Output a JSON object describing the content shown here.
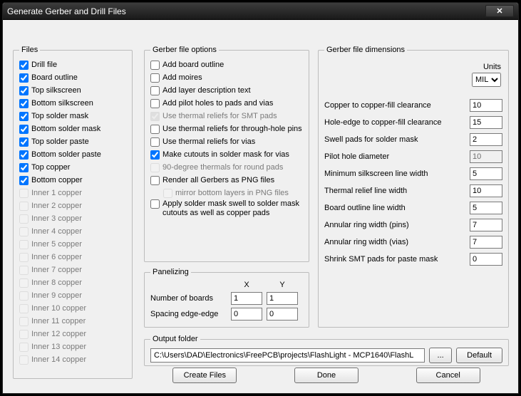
{
  "title": "Generate Gerber and Drill Files",
  "files": {
    "legend": "Files",
    "items": [
      {
        "label": "Drill file",
        "checked": true,
        "enabled": true
      },
      {
        "label": "Board outline",
        "checked": true,
        "enabled": true
      },
      {
        "label": "Top silkscreen",
        "checked": true,
        "enabled": true
      },
      {
        "label": "Bottom silkscreen",
        "checked": true,
        "enabled": true
      },
      {
        "label": "Top solder mask",
        "checked": true,
        "enabled": true
      },
      {
        "label": "Bottom solder mask",
        "checked": true,
        "enabled": true
      },
      {
        "label": "Top solder paste",
        "checked": true,
        "enabled": true
      },
      {
        "label": "Bottom solder paste",
        "checked": true,
        "enabled": true
      },
      {
        "label": "Top copper",
        "checked": true,
        "enabled": true
      },
      {
        "label": "Bottom copper",
        "checked": true,
        "enabled": true
      },
      {
        "label": "Inner 1 copper",
        "checked": false,
        "enabled": false
      },
      {
        "label": "Inner 2 copper",
        "checked": false,
        "enabled": false
      },
      {
        "label": "Inner 3 copper",
        "checked": false,
        "enabled": false
      },
      {
        "label": "Inner 4 copper",
        "checked": false,
        "enabled": false
      },
      {
        "label": "Inner 5 copper",
        "checked": false,
        "enabled": false
      },
      {
        "label": "Inner 6 copper",
        "checked": false,
        "enabled": false
      },
      {
        "label": "Inner 7 copper",
        "checked": false,
        "enabled": false
      },
      {
        "label": "Inner 8 copper",
        "checked": false,
        "enabled": false
      },
      {
        "label": "Inner 9 copper",
        "checked": false,
        "enabled": false
      },
      {
        "label": "Inner 10 copper",
        "checked": false,
        "enabled": false
      },
      {
        "label": "Inner 11 copper",
        "checked": false,
        "enabled": false
      },
      {
        "label": "Inner 12 copper",
        "checked": false,
        "enabled": false
      },
      {
        "label": "Inner 13 copper",
        "checked": false,
        "enabled": false
      },
      {
        "label": "Inner 14 copper",
        "checked": false,
        "enabled": false
      }
    ]
  },
  "gerber_opts": {
    "legend": "Gerber file options",
    "items": [
      {
        "label": "Add board outline",
        "checked": false,
        "enabled": true,
        "indent": false
      },
      {
        "label": "Add moires",
        "checked": false,
        "enabled": true,
        "indent": false
      },
      {
        "label": "Add layer description text",
        "checked": false,
        "enabled": true,
        "indent": false
      },
      {
        "label": "Add pilot holes to pads and vias",
        "checked": false,
        "enabled": true,
        "indent": false
      },
      {
        "label": "Use thermal reliefs for SMT pads",
        "checked": true,
        "enabled": false,
        "indent": false
      },
      {
        "label": "Use thermal reliefs for through-hole pins",
        "checked": false,
        "enabled": true,
        "indent": false
      },
      {
        "label": "Use thermal reliefs for vias",
        "checked": false,
        "enabled": true,
        "indent": false
      },
      {
        "label": "Make cutouts in solder mask for vias",
        "checked": true,
        "enabled": true,
        "indent": false
      },
      {
        "label": "90-degree thermals for round pads",
        "checked": false,
        "enabled": false,
        "indent": false
      },
      {
        "label": "Render all Gerbers as PNG files",
        "checked": false,
        "enabled": true,
        "indent": false
      },
      {
        "label": "mirror bottom layers in PNG files",
        "checked": false,
        "enabled": false,
        "indent": true
      },
      {
        "label": "Apply solder mask swell to solder mask cutouts as well as copper pads",
        "checked": false,
        "enabled": true,
        "indent": false
      }
    ]
  },
  "panelizing": {
    "legend": "Panelizing",
    "x_header": "X",
    "y_header": "Y",
    "rows": [
      {
        "label": "Number of boards",
        "x": "1",
        "y": "1"
      },
      {
        "label": "Spacing edge-edge",
        "x": "0",
        "y": "0"
      }
    ]
  },
  "dims": {
    "legend": "Gerber file dimensions",
    "units_label": "Units",
    "units_value": "MIL",
    "fields": [
      {
        "label": "Copper to copper-fill clearance",
        "value": "10",
        "enabled": true
      },
      {
        "label": "Hole-edge to copper-fill clearance",
        "value": "15",
        "enabled": true
      },
      {
        "label": "Swell pads for solder mask",
        "value": "2",
        "enabled": true
      },
      {
        "label": "Pilot hole diameter",
        "value": "10",
        "enabled": false
      },
      {
        "label": "Minimum silkscreen line width",
        "value": "5",
        "enabled": true
      },
      {
        "label": "Thermal relief line width",
        "value": "10",
        "enabled": true
      },
      {
        "label": "Board outline line width",
        "value": "5",
        "enabled": true
      },
      {
        "label": "Annular ring width (pins)",
        "value": "7",
        "enabled": true
      },
      {
        "label": "Annular ring width (vias)",
        "value": "7",
        "enabled": true
      },
      {
        "label": "Shrink SMT pads for paste mask",
        "value": "0",
        "enabled": true
      }
    ]
  },
  "output": {
    "legend": "Output folder",
    "path": "C:\\Users\\DAD\\Electronics\\FreePCB\\projects\\FlashLight - MCP1640\\FlashL",
    "browse": "...",
    "default": "Default"
  },
  "buttons": {
    "create": "Create Files",
    "done": "Done",
    "cancel": "Cancel"
  }
}
